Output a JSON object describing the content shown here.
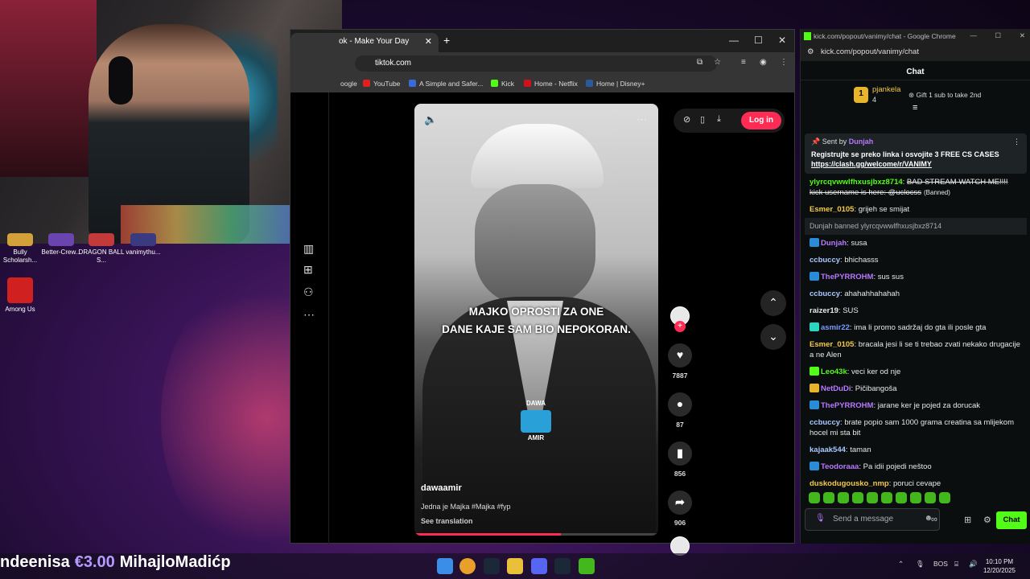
{
  "desktop": {
    "icons": [
      {
        "label": "Bully Scholarsh...",
        "color": "#d4a03a"
      },
      {
        "label": "Better-Crew...",
        "color": "#6a45b0"
      },
      {
        "label": "DRAGON BALL S...",
        "color": "#c23a3a"
      },
      {
        "label": "vanimythu...",
        "color": "#3a3a80"
      },
      {
        "label": "Among Us",
        "color": "#d02020"
      }
    ]
  },
  "tiktok_window": {
    "tab_title": "ok - Make Your Day",
    "url": "tiktok.com",
    "bookmarks": [
      "oogle",
      "YouTube",
      "A Simple and Safer...",
      "Kick",
      "Home - Netflix",
      "Home | Disney+"
    ],
    "login": "Log in",
    "video": {
      "caption_line1": "MAJKO OPROSTI ZA ONE",
      "caption_line2": "DANE KAJE SAM BIO NEPOKORAN.",
      "logo_top": "DAWA",
      "logo_bottom": "AMIR",
      "username": "dawaamir",
      "description": "Jedna je Majka #Majka #fyp",
      "see_translation": "See translation",
      "progress": 0.6
    },
    "actions": {
      "likes": "7887",
      "comments": "87",
      "saves": "856",
      "shares": "906"
    }
  },
  "kick_window": {
    "title": "kick.com/popout/vanimy/chat - Google Chrome",
    "url": "kick.com/popout/vanimy/chat",
    "header": "Chat",
    "top_gifter": {
      "rank": "1",
      "name": "pjankela",
      "count": "4",
      "gift_text": "Gift 1 sub to take 2nd"
    },
    "pinned": {
      "sent_by": "Sent by",
      "user": "Dunjah",
      "message": "Registrujte se preko linka i osvojite 3 FREE CS CASES",
      "link": "https://clash.gg/welcome/r/VANIMY"
    },
    "messages": [
      {
        "user": "ylyrcqvwwlfhxusjbxz8714",
        "text": "BAD STREAM WATCH ME!!!! kick username is here: @uclocss",
        "note": "(Banned)",
        "color": "#53fc18",
        "struck": true
      },
      {
        "user": "Esmer_0105",
        "text": "grijeh se smijat",
        "color": "#f6c945"
      },
      {
        "system": true,
        "text": "Dunjah banned ylyrcqvwwlfhxusjbxz8714"
      },
      {
        "user": "Dunjah",
        "text": "susa",
        "color": "#b879ff",
        "badge": "#2a8bd6"
      },
      {
        "user": "ccbuccy",
        "text": "bhichasss",
        "color": "#a9c8ff"
      },
      {
        "user": "ThePYRROHM",
        "text": "sus sus",
        "color": "#b879ff",
        "badge": "#2a8bd6"
      },
      {
        "user": "ccbuccy",
        "text": "ahahahhahahah",
        "color": "#a9c8ff"
      },
      {
        "user": "raizer19",
        "text": "SUS",
        "color": "#e8e8e8"
      },
      {
        "user": "asmir22",
        "text": "ima li promo sadržaj do gta ili posle gta",
        "color": "#7a9cff",
        "badge": "#2ad6c0"
      },
      {
        "user": "Esmer_0105",
        "text": "bracala jesi li se ti trebao zvati nekako drugacije a ne Alen",
        "color": "#f6c945"
      },
      {
        "user": "Leo43k",
        "text": "veci ker od nje",
        "color": "#53fc18",
        "badge": "#53fc18"
      },
      {
        "user": "NetDuDi",
        "text": "Pičibangoša",
        "color": "#b879ff",
        "badge": "#e8b52a"
      },
      {
        "user": "ThePYRROHM",
        "text": "jarane ker je pojed za dorucak",
        "color": "#b879ff",
        "badge": "#2a8bd6"
      },
      {
        "user": "ccbuccy",
        "text": "brate popio sam 1000 grama creatina sa mlijekom hocel mi sta bit",
        "color": "#a9c8ff"
      },
      {
        "user": "kajaak544",
        "text": "taman",
        "color": "#a9c8ff"
      },
      {
        "user": "Teodoraaa",
        "text": "Pa idii pojedi neštoo",
        "color": "#b879ff",
        "badge": "#2a8bd6"
      },
      {
        "user": "duskodugousko_nmp",
        "text": "poruci cevape",
        "color": "#f6c945"
      }
    ],
    "input_placeholder": "Send a message",
    "chat_button": "Chat"
  },
  "ticker": {
    "name1": "ndeenisa",
    "amount": "€3.00",
    "name2": "MihajloMadićp"
  },
  "taskbar": {
    "lang": "BOS",
    "time": "10:10 PM",
    "date": "12/20/2025"
  }
}
